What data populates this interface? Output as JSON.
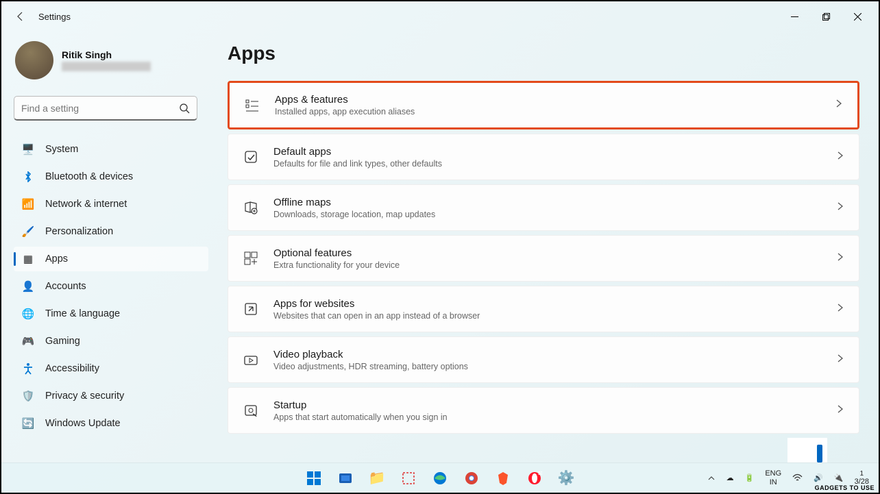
{
  "titlebar": {
    "title": "Settings"
  },
  "user": {
    "name": "Ritik Singh"
  },
  "search": {
    "placeholder": "Find a setting"
  },
  "sidebar": {
    "items": [
      {
        "label": "System",
        "icon": "🖥️",
        "color": "#0078d4"
      },
      {
        "label": "Bluetooth & devices",
        "icon": "bt"
      },
      {
        "label": "Network & internet",
        "icon": "📶",
        "color": "#00a2ed"
      },
      {
        "label": "Personalization",
        "icon": "🖌️"
      },
      {
        "label": "Apps",
        "icon": "▦",
        "active": true
      },
      {
        "label": "Accounts",
        "icon": "👤",
        "color": "#2e8b57"
      },
      {
        "label": "Time & language",
        "icon": "🌐"
      },
      {
        "label": "Gaming",
        "icon": "🎮",
        "color": "#888"
      },
      {
        "label": "Accessibility",
        "icon": "acc"
      },
      {
        "label": "Privacy & security",
        "icon": "🛡️",
        "color": "#888"
      },
      {
        "label": "Windows Update",
        "icon": "🔄",
        "color": "#0078d4"
      }
    ]
  },
  "page": {
    "title": "Apps"
  },
  "cards": [
    {
      "title": "Apps & features",
      "sub": "Installed apps, app execution aliases",
      "highlighted": true
    },
    {
      "title": "Default apps",
      "sub": "Defaults for file and link types, other defaults"
    },
    {
      "title": "Offline maps",
      "sub": "Downloads, storage location, map updates"
    },
    {
      "title": "Optional features",
      "sub": "Extra functionality for your device"
    },
    {
      "title": "Apps for websites",
      "sub": "Websites that can open in an app instead of a browser"
    },
    {
      "title": "Video playback",
      "sub": "Video adjustments, HDR streaming, battery options"
    },
    {
      "title": "Startup",
      "sub": "Apps that start automatically when you sign in"
    }
  ],
  "taskbar": {
    "lang1": "ENG",
    "lang2": "IN",
    "date": "3/28"
  },
  "watermark": "GADGETS TO USE"
}
